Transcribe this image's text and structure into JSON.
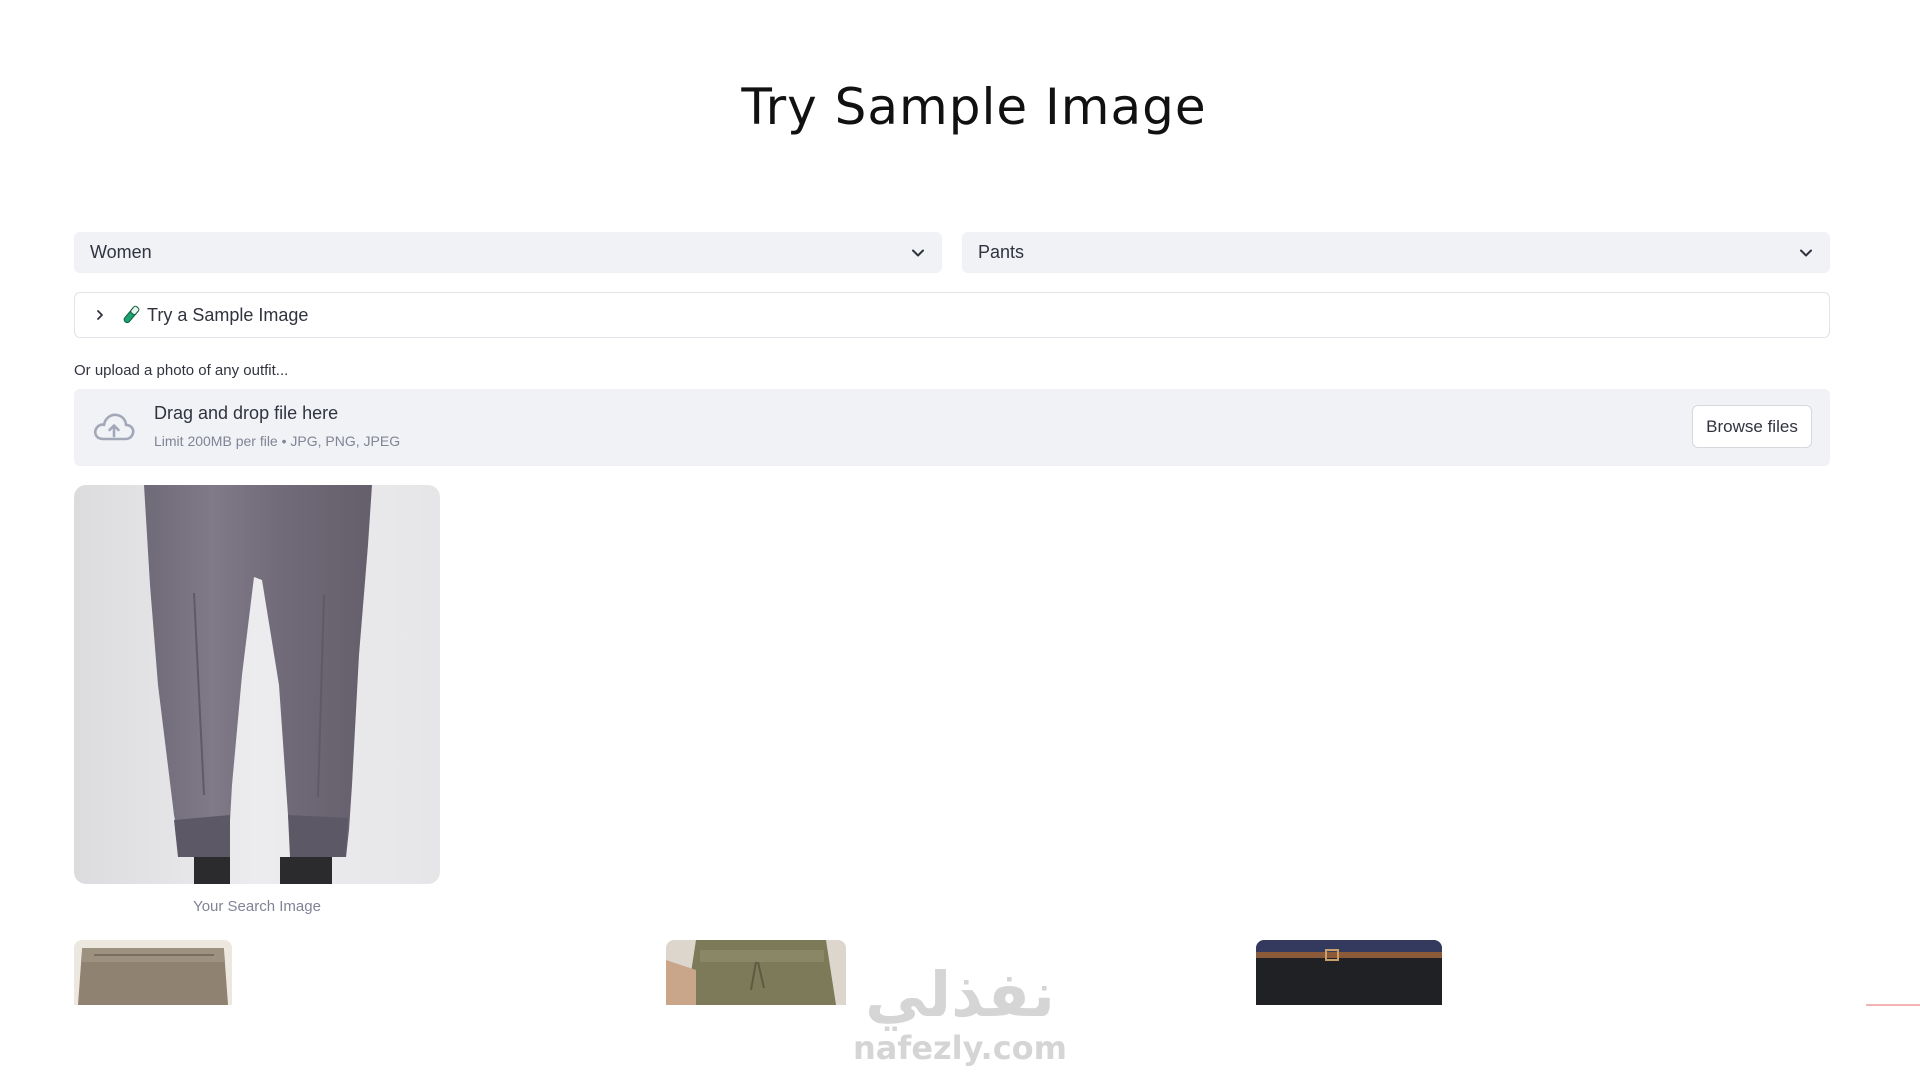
{
  "page": {
    "title": "Try Sample Image"
  },
  "filters": {
    "gender": {
      "value": "Women"
    },
    "category": {
      "value": "Pants"
    }
  },
  "expander": {
    "label": "Try a Sample Image",
    "icon": "flask-icon"
  },
  "upload": {
    "label": "Or upload a photo of any outfit...",
    "dropzone_title": "Drag and drop file here",
    "dropzone_limit": "Limit 200MB per file • JPG, PNG, JPEG",
    "browse_label": "Browse files",
    "icon": "cloud-upload-icon"
  },
  "search_image": {
    "caption": "Your Search Image"
  },
  "watermark": {
    "arabic": "نفذلي",
    "latin": "nafezly.com"
  },
  "colors": {
    "select_bg": "#f0f2f6",
    "text": "#31333f",
    "muted": "#808495",
    "flask_green": "#1aa36f"
  }
}
